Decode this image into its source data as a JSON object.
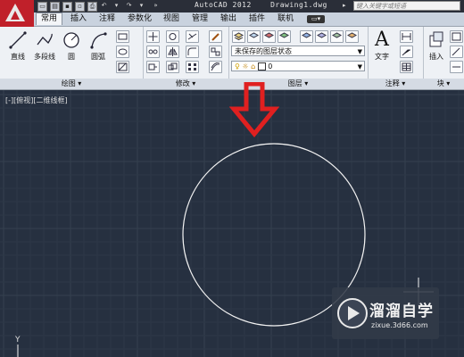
{
  "titlebar": {
    "app_name": "AutoCAD 2012",
    "file_name": "Drawing1.dwg",
    "search_placeholder": "键入关键字或短语",
    "quick_access": [
      "new",
      "open",
      "save",
      "print",
      "undo",
      "redo"
    ]
  },
  "tabs": [
    {
      "label": "常用",
      "active": true
    },
    {
      "label": "插入"
    },
    {
      "label": "注释"
    },
    {
      "label": "参数化"
    },
    {
      "label": "视图"
    },
    {
      "label": "管理"
    },
    {
      "label": "输出"
    },
    {
      "label": "插件"
    },
    {
      "label": "联机"
    }
  ],
  "ribbon": {
    "draw": {
      "panel_label": "绘图 ▾",
      "line": "直线",
      "polyline": "多段线",
      "circle": "圆",
      "arc": "圆弧"
    },
    "modify": {
      "panel_label": "修改 ▾"
    },
    "layers": {
      "panel_label": "图层 ▾",
      "layer_state": "未保存的图层状态",
      "current_layer": "0"
    },
    "annotation": {
      "panel_label": "注释 ▾",
      "text": "文字",
      "text_glyph": "A"
    },
    "block": {
      "panel_label": "块 ▾",
      "insert": "插入"
    }
  },
  "viewport": {
    "label": "[-][俯视][二维线框]",
    "ucs_y": "Y"
  },
  "watermark": {
    "title": "溜溜自学",
    "url": "zixue.3d66.com"
  },
  "colors": {
    "canvas": "#263040",
    "annotation_arrow": "#e02020",
    "circle": "#ffffff"
  }
}
